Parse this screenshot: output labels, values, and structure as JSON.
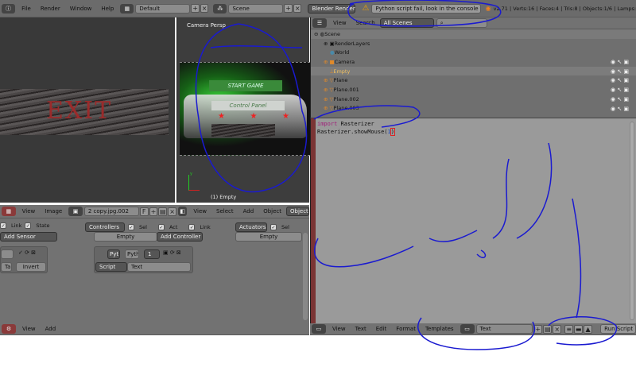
{
  "top_bar": {
    "menus": [
      "File",
      "Render",
      "Window",
      "Help"
    ],
    "layout": "Default",
    "scene": "Scene",
    "engine": "Blender Render",
    "report": "Python script fail, look in the console for now...",
    "stats": "v2.71 | Verts:16 | Faces:4 | Tris:8 | Objects:1/6 | Lamps:"
  },
  "image_editor": {
    "image_text": "EXIT",
    "header": {
      "menus": [
        "View",
        "Image"
      ],
      "image_name": "2 copy.jpg.002",
      "f_label": "F"
    }
  },
  "viewport": {
    "title": "Camera Persp",
    "object_label": "(1) Empty",
    "axis_y": "y",
    "menu_start": "START GAME",
    "menu_control": "Control Panel",
    "header": {
      "menus": [
        "View",
        "Select",
        "Add",
        "Object"
      ],
      "mode": "Object Mode"
    }
  },
  "outliner": {
    "header": {
      "menus": [
        "View",
        "Search"
      ],
      "display": "All Scenes"
    },
    "items": [
      {
        "name": "Scene",
        "icon": "scene"
      },
      {
        "name": "RenderLayers",
        "icon": "renderlayers"
      },
      {
        "name": "World",
        "icon": "world"
      },
      {
        "name": "Camera",
        "icon": "camera"
      },
      {
        "name": "Empty",
        "icon": "empty"
      },
      {
        "name": "Plane",
        "icon": "mesh"
      },
      {
        "name": "Plane.001",
        "icon": "mesh"
      },
      {
        "name": "Plane.002",
        "icon": "mesh"
      },
      {
        "name": "Plane.003",
        "icon": "mesh"
      }
    ]
  },
  "text_editor": {
    "code": [
      {
        "kw": "import",
        "rest": " Rasterizer"
      },
      {
        "kw": "",
        "rest": "Rasterizer.showMouse(",
        "arg": "1",
        "close": ")"
      }
    ],
    "header": {
      "menus": [
        "View",
        "Text",
        "Edit",
        "Format",
        "Templates"
      ],
      "text_name": "Text",
      "run_label": "Run Script"
    }
  },
  "logic_editor": {
    "sensors": {
      "link": "Link",
      "state": "State",
      "add": "Add Sensor",
      "tap": "Tap",
      "invert": "Invert"
    },
    "controllers": {
      "label": "Controllers",
      "sel": "Sel",
      "act": "Act",
      "link": "Link",
      "empty": "Empty",
      "add": "Add Controller",
      "type": "Pyt",
      "pyth": "Pyth",
      "num": "1",
      "script": "Script",
      "text": "Text"
    },
    "actuators": {
      "label": "Actuators",
      "sel": "Sel",
      "empty": "Empty"
    }
  },
  "bottom_left_header": {
    "menus": [
      "View",
      "Add"
    ]
  }
}
